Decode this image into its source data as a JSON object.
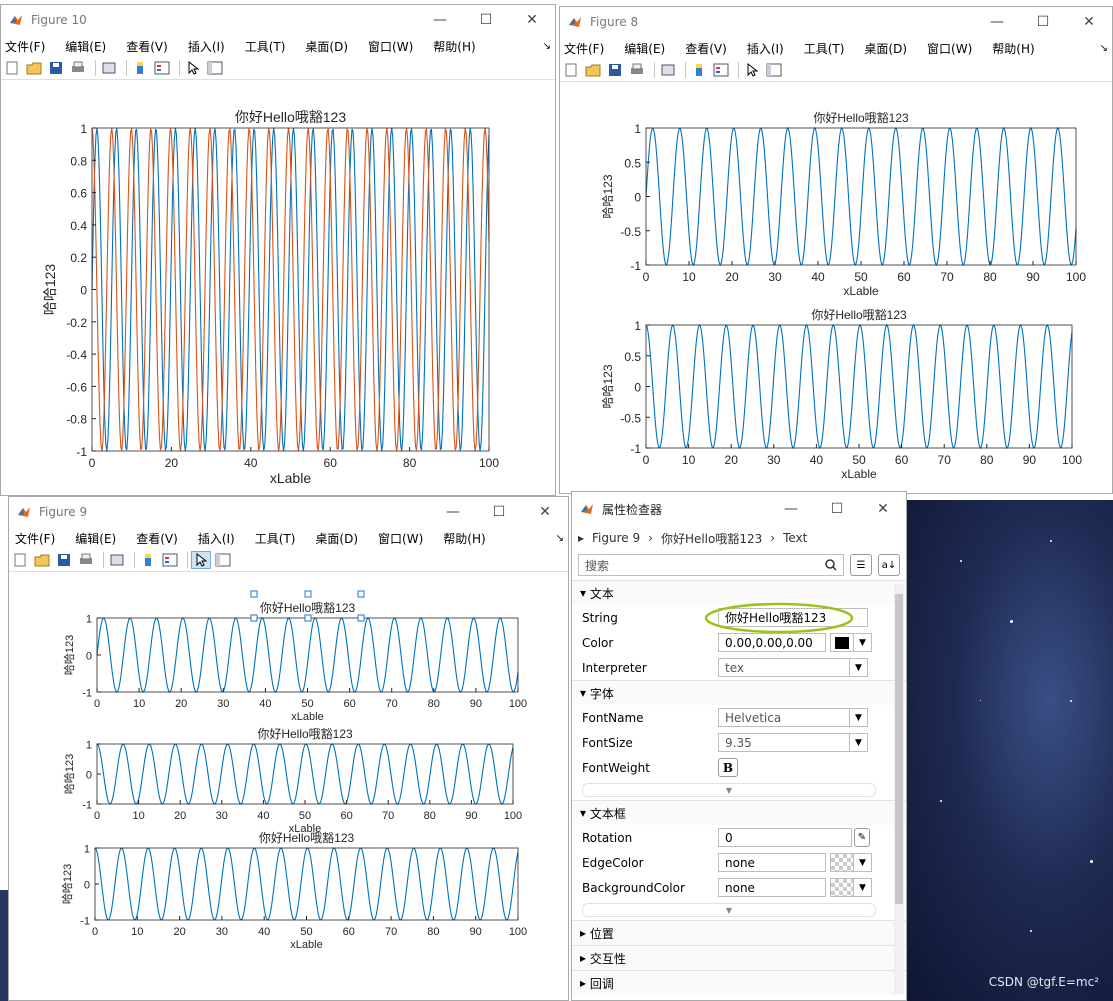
{
  "menu": [
    "文件(F)",
    "编辑(E)",
    "查看(V)",
    "插入(I)",
    "工具(T)",
    "桌面(D)",
    "窗口(W)",
    "帮助(H)"
  ],
  "win_controls": {
    "min": "—",
    "max": "☐",
    "close": "✕"
  },
  "plot_title": "你好Hello哦豁123",
  "xlabel": "xLable",
  "ylabel": "哈哈123",
  "fig10": {
    "window_title": "Figure 10",
    "chart_data": {
      "type": "line",
      "title": "你好Hello哦豁123",
      "xlabel": "xLable",
      "ylabel": "哈哈123",
      "xlim": [
        0,
        100
      ],
      "ylim": [
        -1,
        1
      ],
      "xticks": [
        "0",
        "20",
        "40",
        "60",
        "80",
        "100"
      ],
      "yticks": [
        "1",
        "0.8",
        "0.6",
        "0.4",
        "0.2",
        "0",
        "-0.2",
        "-0.4",
        "-0.6",
        "-0.8",
        "-1"
      ],
      "series": [
        {
          "color": "#0072BD",
          "function": "sin",
          "period": 4.95
        },
        {
          "color": "#D95319",
          "function": "cos",
          "period": 4.95
        }
      ]
    }
  },
  "fig8": {
    "window_title": "Figure 8",
    "chart_data": [
      {
        "type": "line",
        "title": "你好Hello哦豁123",
        "xlabel": "xLable",
        "ylabel": "哈哈123",
        "xlim": [
          0,
          100
        ],
        "ylim": [
          -1,
          1
        ],
        "xticks": [
          "0",
          "10",
          "20",
          "30",
          "40",
          "50",
          "60",
          "70",
          "80",
          "90",
          "100"
        ],
        "yticks": [
          "1",
          "0.5",
          "0",
          "-0.5",
          "-1"
        ],
        "series": [
          {
            "color": "#0072BD",
            "function": "sin",
            "period": 6.28
          }
        ]
      },
      {
        "type": "line",
        "title": "你好Hello哦豁123",
        "xlabel": "xLable",
        "ylabel": "哈哈123",
        "xlim": [
          0,
          100
        ],
        "ylim": [
          -1,
          1
        ],
        "xticks": [
          "0",
          "10",
          "20",
          "30",
          "40",
          "50",
          "60",
          "70",
          "80",
          "90",
          "100"
        ],
        "yticks": [
          "1",
          "0.5",
          "0",
          "-0.5",
          "-1"
        ],
        "series": [
          {
            "color": "#0072BD",
            "function": "cos",
            "period": 6.28
          }
        ]
      }
    ]
  },
  "fig9": {
    "window_title": "Figure 9",
    "chart_data": [
      {
        "type": "line",
        "title": "你好Hello哦豁123",
        "xlabel": "xLable",
        "ylabel": "哈哈123",
        "xlim": [
          0,
          100
        ],
        "ylim": [
          -1,
          1
        ],
        "xticks": [
          "0",
          "10",
          "20",
          "30",
          "40",
          "50",
          "60",
          "70",
          "80",
          "90",
          "100"
        ],
        "yticks": [
          "1",
          "0",
          "-1"
        ],
        "series": [
          {
            "color": "#0072BD",
            "function": "sin",
            "period": 6.28
          }
        ]
      },
      {
        "type": "line",
        "title": "你好Hello哦豁123",
        "xlabel": "xLable",
        "ylabel": "哈哈123",
        "xlim": [
          0,
          100
        ],
        "ylim": [
          -1,
          1
        ],
        "xticks": [
          "0",
          "10",
          "20",
          "30",
          "40",
          "50",
          "60",
          "70",
          "80",
          "90",
          "100"
        ],
        "yticks": [
          "1",
          "0",
          "-1"
        ],
        "series": [
          {
            "color": "#0072BD",
            "function": "cos",
            "period": 6.28
          }
        ]
      },
      {
        "type": "line",
        "title": "你好Hello哦豁123",
        "xlabel": "xLable",
        "ylabel": "哈哈123",
        "xlim": [
          0,
          100
        ],
        "ylim": [
          -1,
          1
        ],
        "xticks": [
          "0",
          "10",
          "20",
          "30",
          "40",
          "50",
          "60",
          "70",
          "80",
          "90",
          "100"
        ],
        "yticks": [
          "1",
          "0",
          "-1"
        ],
        "series": [
          {
            "color": "#0072BD",
            "function": "cos",
            "period": 6.28
          }
        ]
      }
    ]
  },
  "inspector": {
    "title": "属性检查器",
    "crumbs": [
      "Figure 9",
      "你好Hello哦豁123",
      "Text"
    ],
    "search_placeholder": "搜索",
    "section_text": "文本",
    "string_label": "String",
    "string_value": "你好Hello哦豁123",
    "color_label": "Color",
    "color_value": "0.00,0.00,0.00",
    "interpreter_label": "Interpreter",
    "interpreter_value": "tex",
    "section_font": "字体",
    "fontname_label": "FontName",
    "fontname_value": "Helvetica",
    "fontsize_label": "FontSize",
    "fontsize_value": "9.35",
    "fontweight_label": "FontWeight",
    "fontweight_value": "B",
    "section_box": "文本框",
    "rotation_label": "Rotation",
    "rotation_value": "0",
    "edgecolor_label": "EdgeColor",
    "edgecolor_value": "none",
    "bgcolor_label": "BackgroundColor",
    "bgcolor_value": "none",
    "section_position": "位置",
    "section_interact": "交互性",
    "section_callback": "回调"
  },
  "watermark": "CSDN @tgf.E=mc²",
  "colors": {
    "blue": "#0072BD",
    "orange": "#D95319",
    "accent": "#9bc31f"
  }
}
